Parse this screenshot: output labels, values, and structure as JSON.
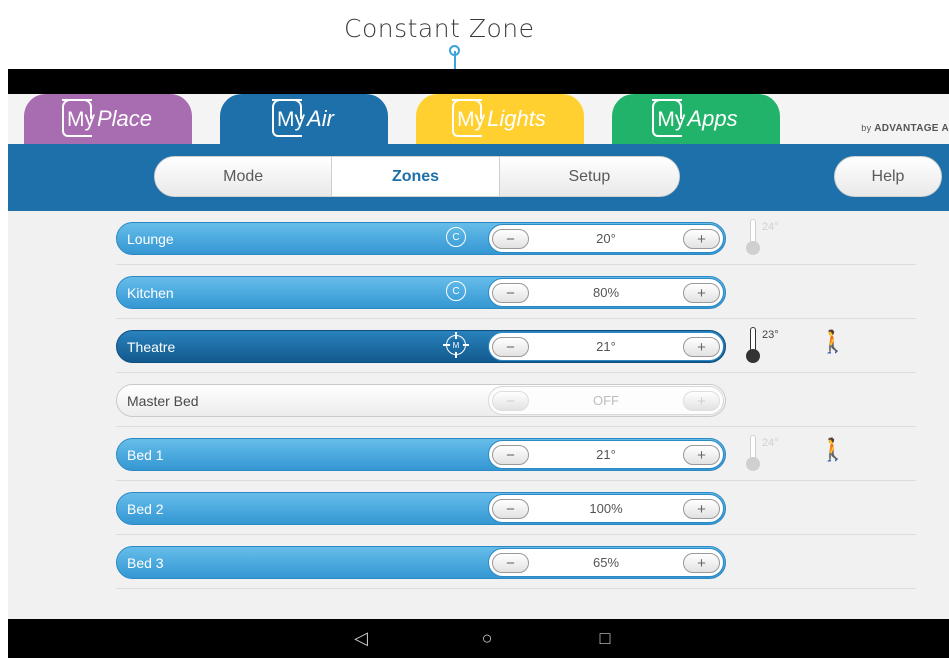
{
  "callout": {
    "title": "Constant Zone"
  },
  "apps": [
    {
      "my": "My",
      "name": "Place",
      "color": "#a86db0"
    },
    {
      "my": "My",
      "name": "Air",
      "color": "#1d70a9"
    },
    {
      "my": "My",
      "name": "Lights",
      "color": "#ffd030"
    },
    {
      "my": "My",
      "name": "Apps",
      "color": "#22b36a"
    }
  ],
  "brand_footer": {
    "prefix": "by",
    "name": "ADVANTAGE A"
  },
  "nav": {
    "segments": [
      "Mode",
      "Zones",
      "Setup"
    ],
    "active": "Zones",
    "help": "Help"
  },
  "zones": [
    {
      "name": "Lounge",
      "value": "20°",
      "style": "blue",
      "icon": "c-icon",
      "icon_text": "C",
      "temp": "24°",
      "temp_active": false,
      "walker": ""
    },
    {
      "name": "Kitchen",
      "value": "80%",
      "style": "blue",
      "icon": "c-icon",
      "icon_text": "C",
      "temp": "",
      "temp_active": false,
      "walker": ""
    },
    {
      "name": "Theatre",
      "value": "21°",
      "style": "dark",
      "icon": "target-icon",
      "icon_text": "M",
      "temp": "23°",
      "temp_active": true,
      "walker": "inactive"
    },
    {
      "name": "Master Bed",
      "value": "OFF",
      "style": "grey",
      "icon": "",
      "icon_text": "",
      "temp": "",
      "temp_active": false,
      "walker": ""
    },
    {
      "name": "Bed 1",
      "value": "21°",
      "style": "blue",
      "icon": "",
      "icon_text": "",
      "temp": "24°",
      "temp_active": false,
      "walker": "active"
    },
    {
      "name": "Bed 2",
      "value": "100%",
      "style": "blue",
      "icon": "",
      "icon_text": "",
      "temp": "",
      "temp_active": false,
      "walker": ""
    },
    {
      "name": "Bed 3",
      "value": "65%",
      "style": "blue",
      "icon": "",
      "icon_text": "",
      "temp": "",
      "temp_active": false,
      "walker": ""
    }
  ],
  "controls": {
    "minus": "−",
    "plus": "+"
  },
  "system_bar": {
    "back": "◁",
    "home": "○",
    "recents": "□"
  }
}
